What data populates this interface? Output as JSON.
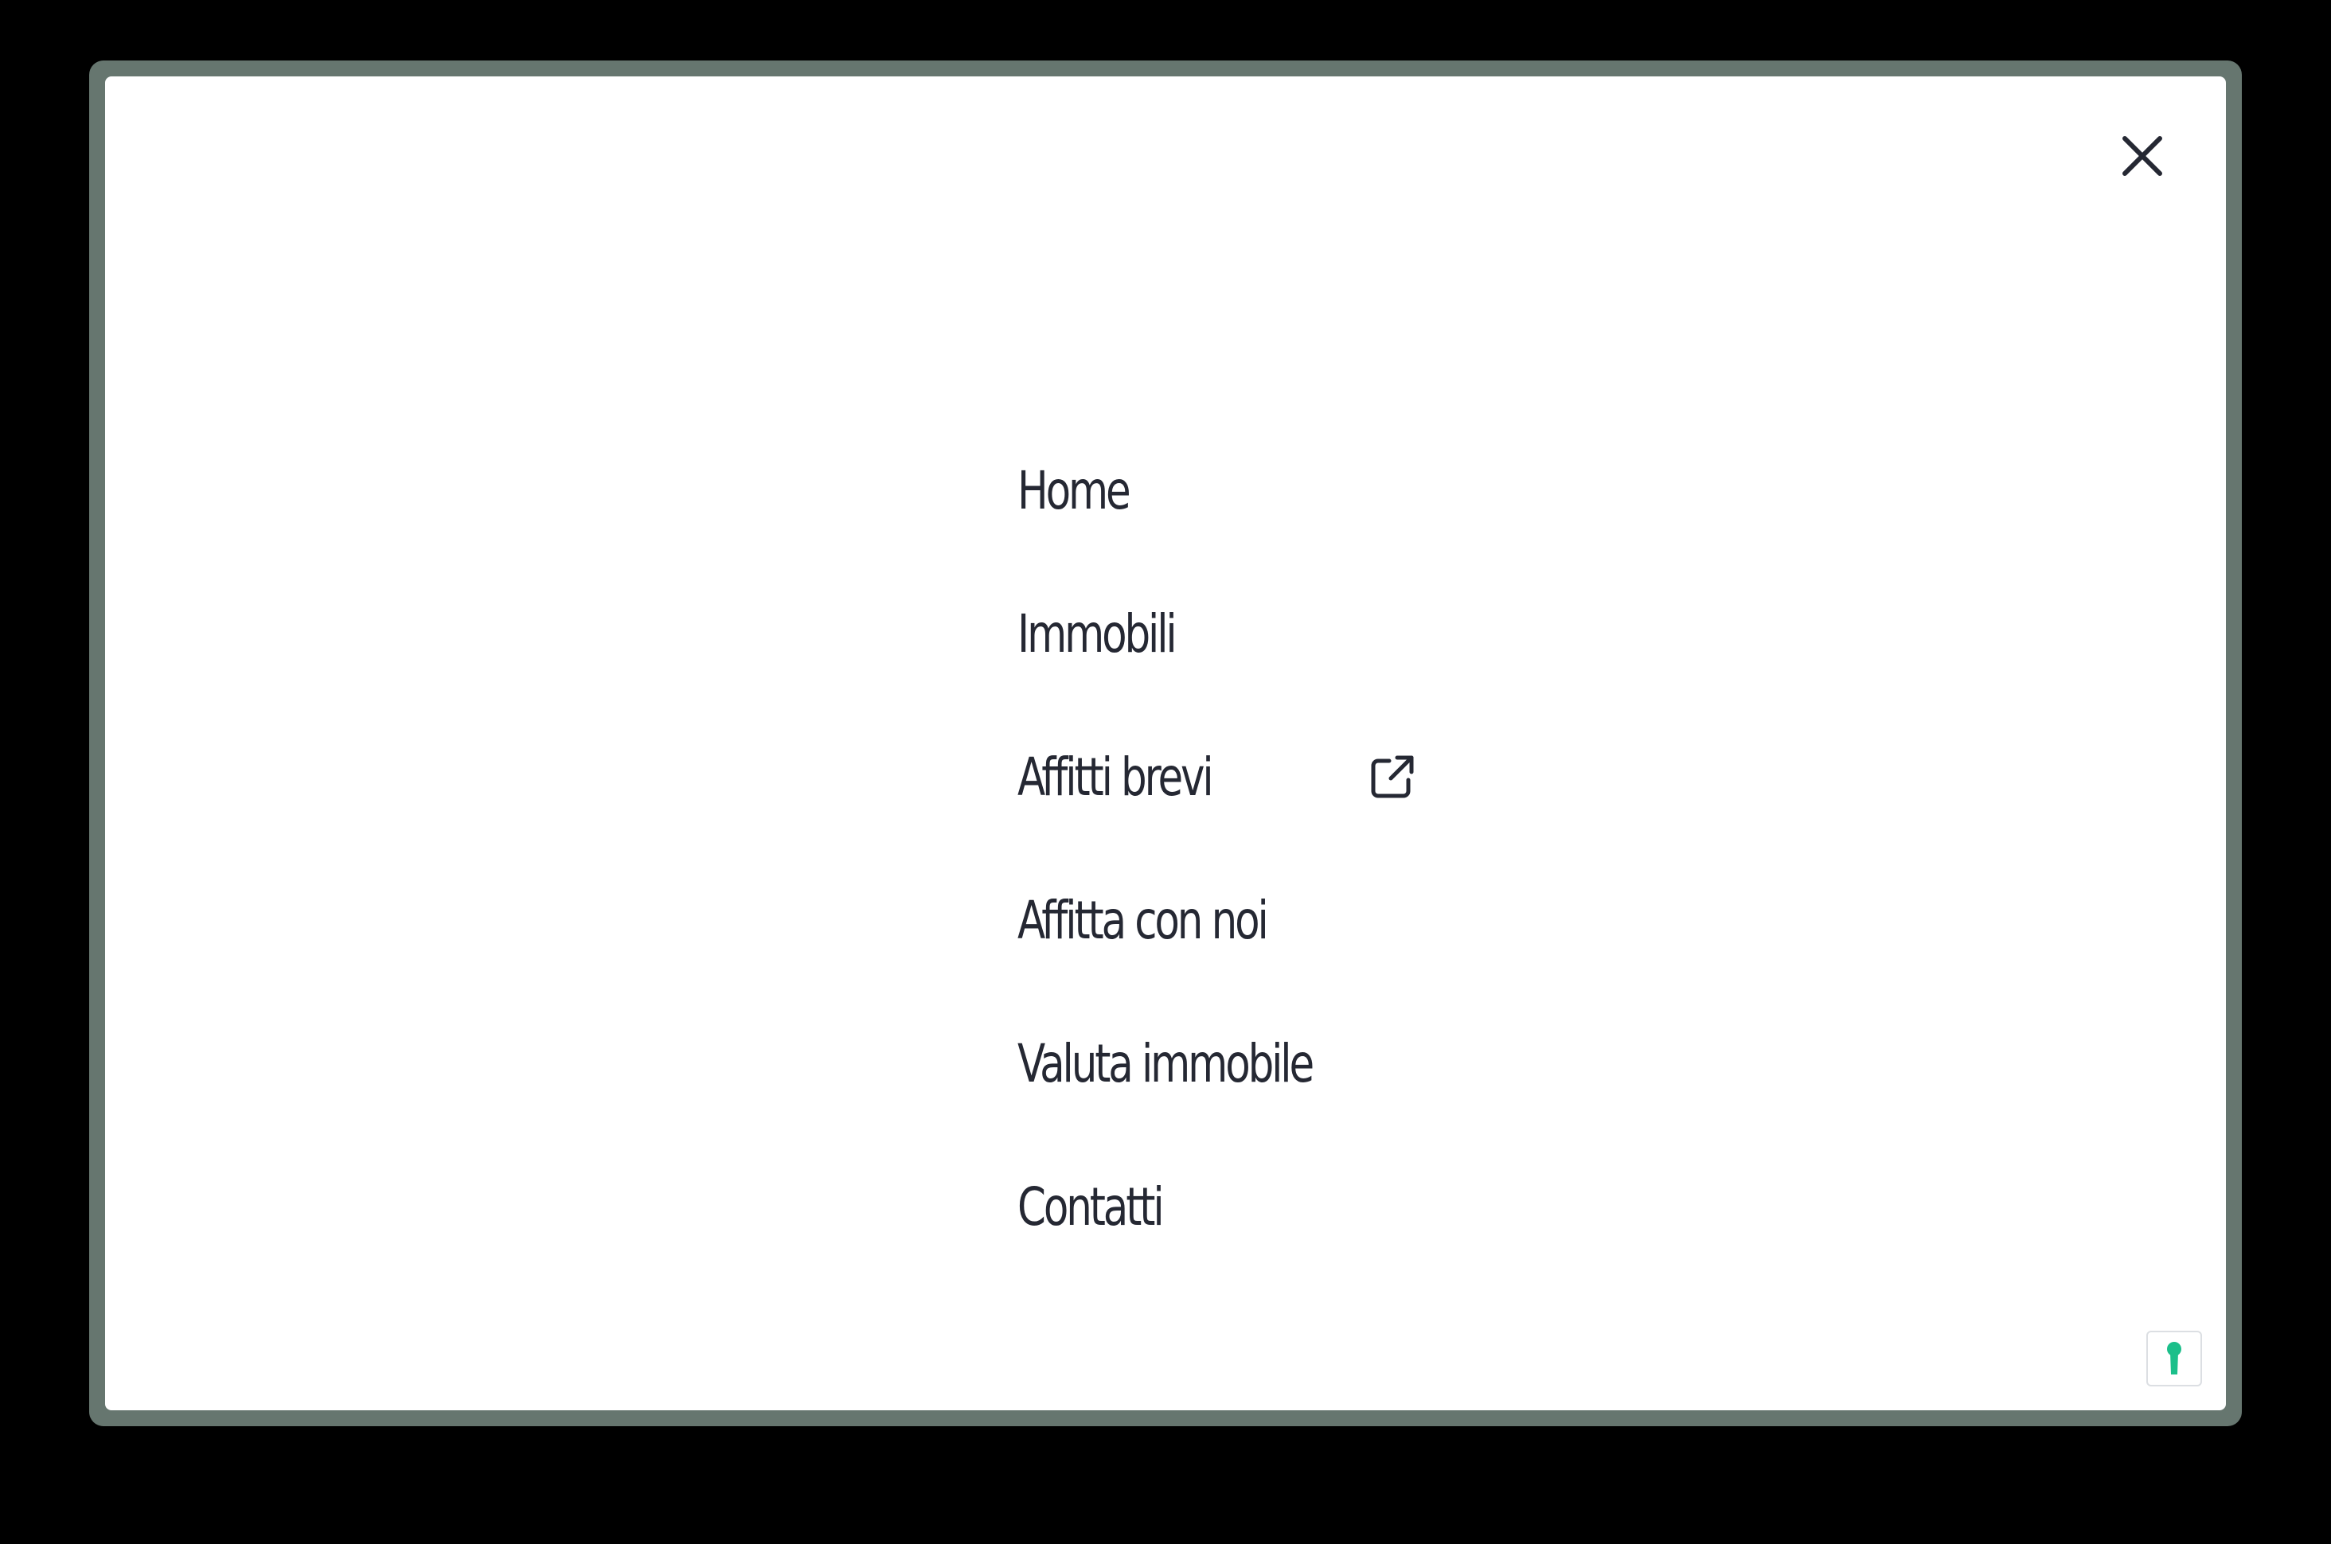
{
  "menu": {
    "close_icon": "close-icon",
    "items": [
      {
        "label": "Home"
      },
      {
        "label": "Immobili"
      },
      {
        "label": "Affitti brevi",
        "icon": "external-link-icon"
      },
      {
        "label": "Affitta con noi"
      },
      {
        "label": "Valuta immobile"
      },
      {
        "label": "Contatti"
      }
    ]
  },
  "badge": {
    "icon": "keyhole-icon",
    "color": "#1bbf8a"
  },
  "colors": {
    "frame": "#66766f",
    "text": "#252833",
    "background": "#ffffff"
  }
}
